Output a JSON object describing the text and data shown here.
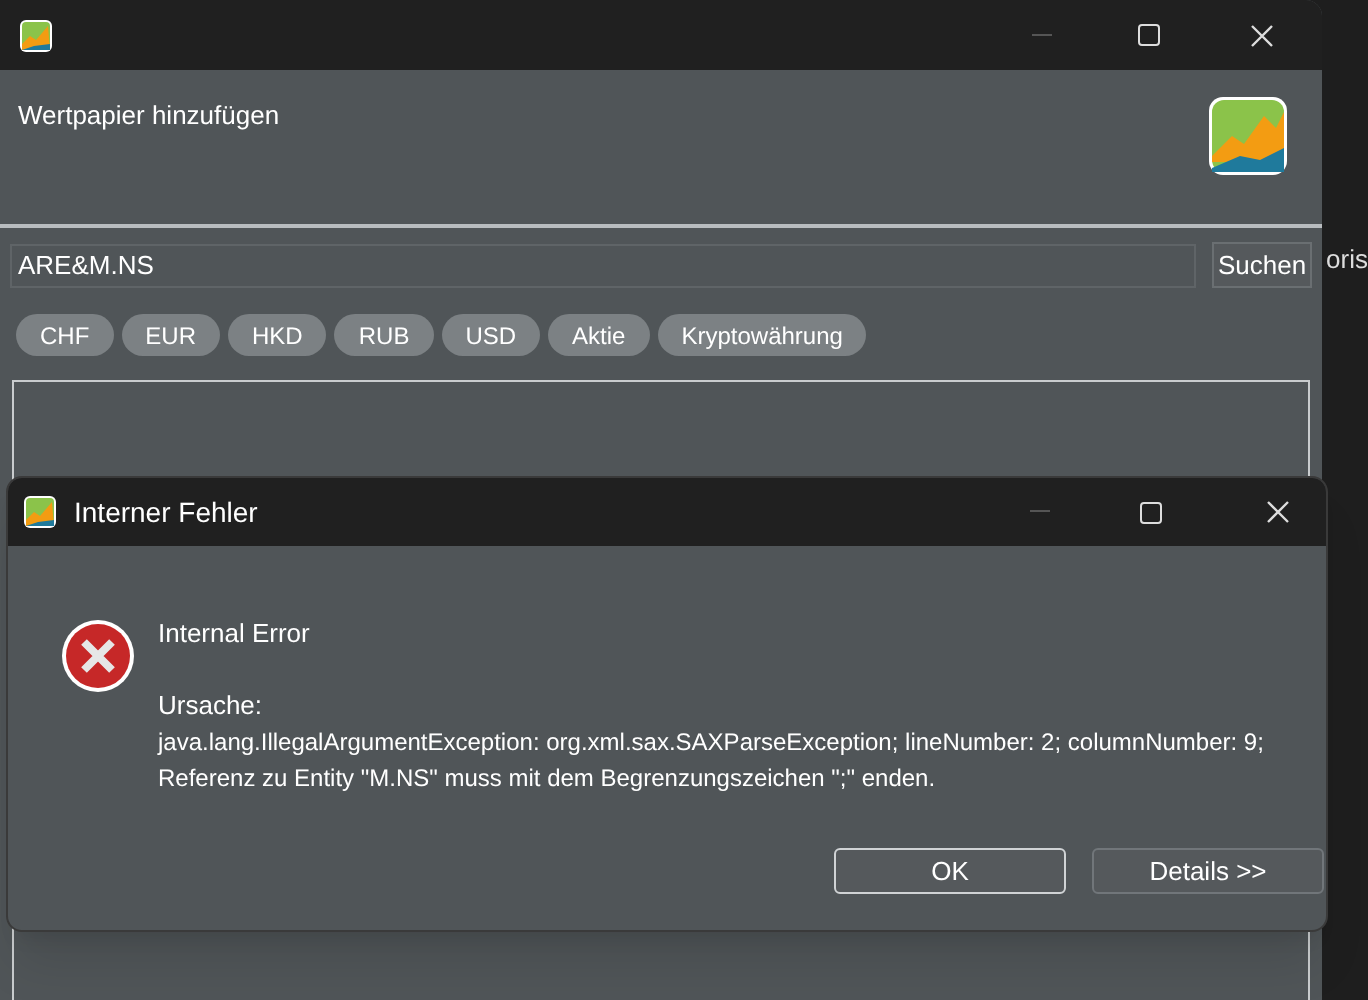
{
  "background_window": {
    "text": "oris"
  },
  "main_window": {
    "header_title": "Wertpapier hinzufügen",
    "search": {
      "value": "ARE&M.NS"
    },
    "search_button": "Suchen",
    "filters": [
      {
        "label": "CHF"
      },
      {
        "label": "EUR"
      },
      {
        "label": "HKD"
      },
      {
        "label": "RUB"
      },
      {
        "label": "USD"
      },
      {
        "label": "Aktie"
      },
      {
        "label": "Kryptowährung"
      }
    ]
  },
  "dialog": {
    "title": "Interner Fehler",
    "heading": "Internal Error",
    "cause_label": "Ursache:",
    "message": "java.lang.IllegalArgumentException: org.xml.sax.SAXParseException; lineNumber: 2; columnNumber: 9; Referenz zu Entity \"M.NS\" muss mit dem Begrenzungszeichen \";\" enden.",
    "buttons": [
      {
        "label": "OK",
        "default": true
      },
      {
        "label": "Details >>",
        "default": false
      }
    ]
  }
}
